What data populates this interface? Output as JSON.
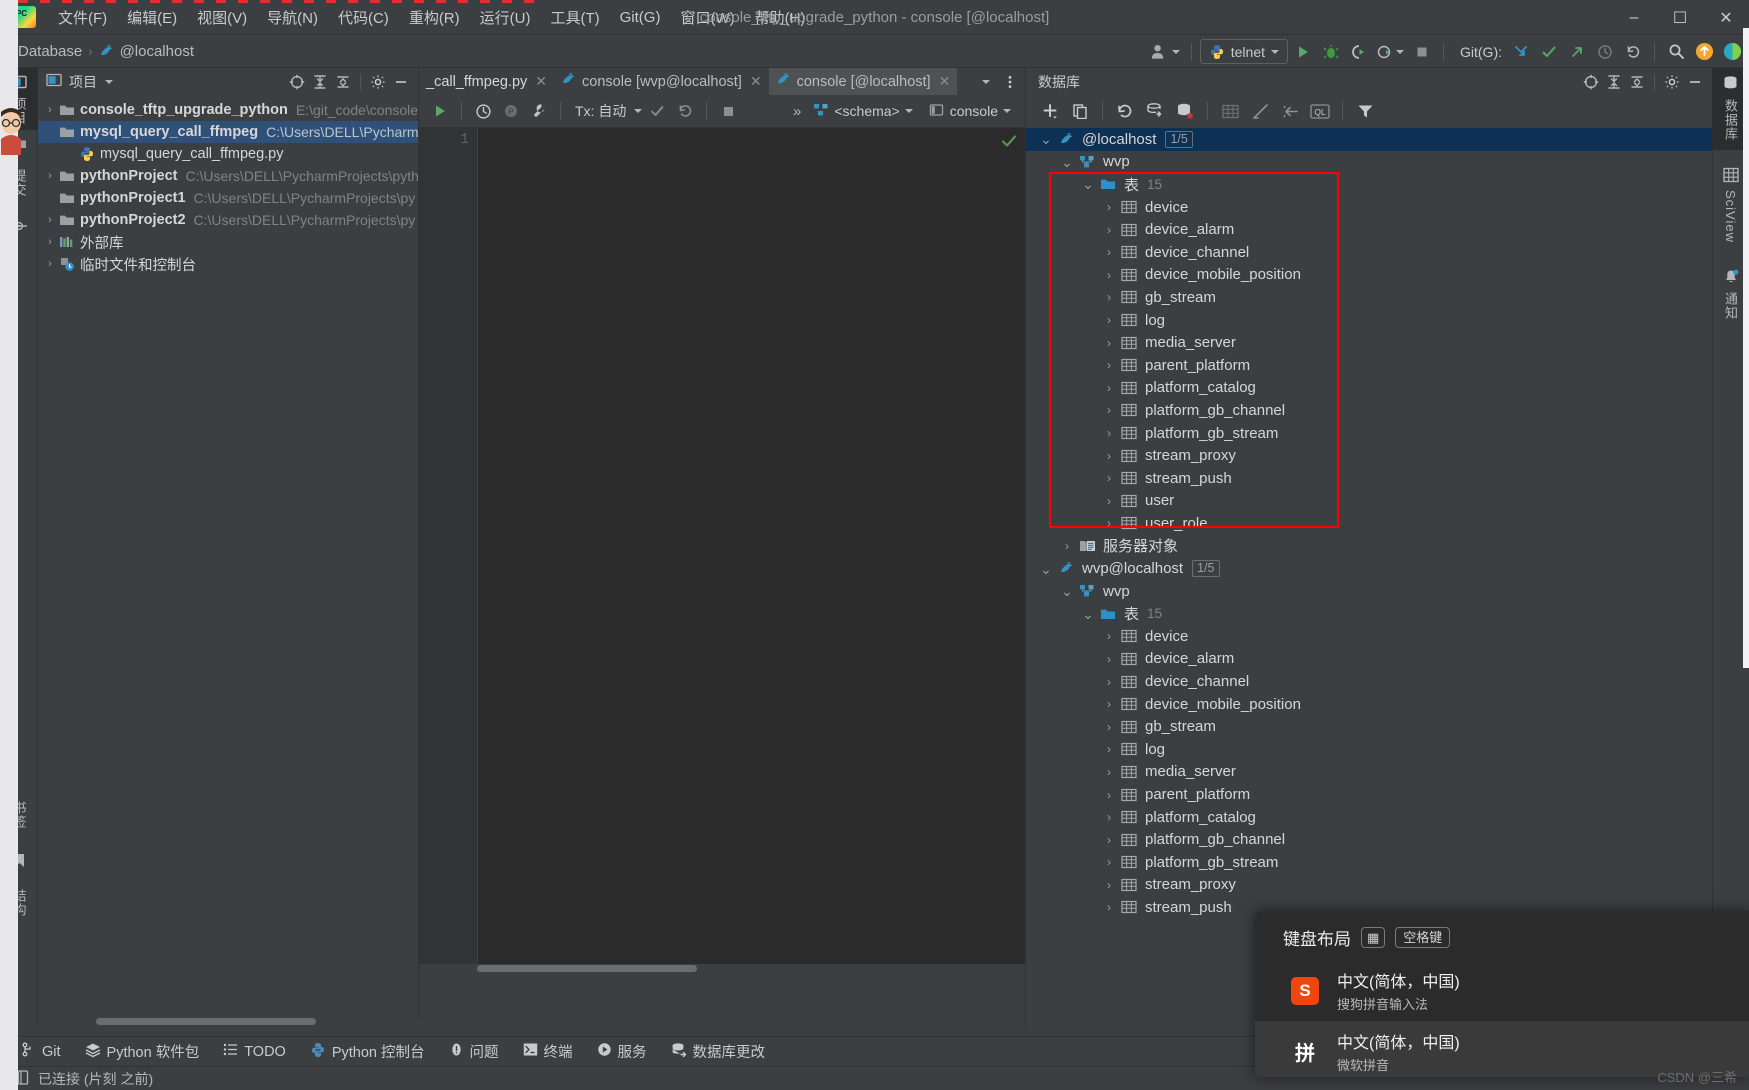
{
  "window": {
    "title": "console_tftp_upgrade_python - console [@localhost]",
    "minimize": "–",
    "maximize": "☐",
    "close": "✕"
  },
  "menubar": {
    "items": [
      {
        "label": "文件(F)"
      },
      {
        "label": "编辑(E)"
      },
      {
        "label": "视图(V)"
      },
      {
        "label": "导航(N)"
      },
      {
        "label": "代码(C)"
      },
      {
        "label": "重构(R)"
      },
      {
        "label": "运行(U)"
      },
      {
        "label": "工具(T)"
      },
      {
        "label": "Git(G)"
      },
      {
        "label": "窗口(W)"
      },
      {
        "label": "帮助(H)"
      }
    ]
  },
  "navbar": {
    "breadcrumb": [
      "Database",
      "@localhost"
    ],
    "separator": "›",
    "run_config": "telnet",
    "git_label": "Git(G):"
  },
  "left_strip": {
    "tabs": [
      {
        "label": "项目",
        "icon": "project-icon",
        "active": true
      },
      {
        "label": "",
        "icon": "folder-icon",
        "active": false
      },
      {
        "label": "提交",
        "icon": "commit-icon",
        "active": false
      },
      {
        "label": "",
        "icon": "structure-node-icon",
        "active": false
      },
      {
        "label": "书签",
        "icon": "bookmark-icon",
        "active": false
      },
      {
        "label": "结构",
        "icon": "structure-icon",
        "active": false
      }
    ]
  },
  "right_strip": {
    "tabs": [
      {
        "label": "数据库",
        "icon": "database-icon",
        "active": true
      },
      {
        "label": "SciView",
        "icon": "grid-icon",
        "active": false
      },
      {
        "label": "通知",
        "icon": "bell-icon",
        "active": false
      }
    ]
  },
  "project_panel": {
    "title": "项目",
    "tree": [
      {
        "indent": 0,
        "arrow": "›",
        "icon": "folder-icon",
        "label": "console_tftp_upgrade_python",
        "bold": true,
        "path": "E:\\git_code\\console",
        "selected": false
      },
      {
        "indent": 0,
        "arrow": "ⱟ",
        "icon": "folder-icon",
        "label": "mysql_query_call_ffmpeg",
        "bold": true,
        "path": "C:\\Users\\DELL\\PycharmP",
        "selected": true
      },
      {
        "indent": 1,
        "arrow": "",
        "icon": "python-file-icon",
        "label": "mysql_query_call_ffmpeg.py",
        "bold": false,
        "path": "",
        "selected": false
      },
      {
        "indent": 0,
        "arrow": "›",
        "icon": "folder-icon",
        "label": "pythonProject",
        "bold": true,
        "path": "C:\\Users\\DELL\\PycharmProjects\\pyth",
        "selected": false
      },
      {
        "indent": 0,
        "arrow": "ⱟ",
        "icon": "folder-icon",
        "label": "pythonProject1",
        "bold": true,
        "path": "C:\\Users\\DELL\\PycharmProjects\\py",
        "selected": false
      },
      {
        "indent": 0,
        "arrow": "›",
        "icon": "folder-icon",
        "label": "pythonProject2",
        "bold": true,
        "path": "C:\\Users\\DELL\\PycharmProjects\\py",
        "selected": false
      },
      {
        "indent": 0,
        "arrow": "›",
        "icon": "external-lib-icon",
        "label": "外部库",
        "bold": false,
        "path": "",
        "selected": false
      },
      {
        "indent": 0,
        "arrow": "›",
        "icon": "scratch-icon",
        "label": "临时文件和控制台",
        "bold": false,
        "path": "",
        "selected": false
      }
    ]
  },
  "editor": {
    "tabs": [
      {
        "label": "_call_ffmpeg.py",
        "icon": "python-file-icon",
        "active": false,
        "close": "✕"
      },
      {
        "label": "console [wvp@localhost]",
        "icon": "dolphin-icon",
        "active": false,
        "close": "✕"
      },
      {
        "label": "console [@localhost]",
        "icon": "dolphin-icon",
        "active": true,
        "close": "✕"
      }
    ],
    "console_toolbar": {
      "tx_label": "Tx:",
      "tx_value": "自动",
      "overflow": "»",
      "schema": "<schema>",
      "session": "console"
    },
    "gutter_lines": [
      "1"
    ],
    "code_text": ""
  },
  "database_panel": {
    "title": "数据库",
    "tree": [
      {
        "indent": 0,
        "arrow": "ⱟ",
        "icon": "dolphin-icon",
        "label": "@localhost",
        "badge": "1/5",
        "count": "",
        "selected": true
      },
      {
        "indent": 1,
        "arrow": "ⱟ",
        "icon": "schema-icon",
        "label": "wvp",
        "badge": "",
        "count": "",
        "selected": false
      },
      {
        "indent": 2,
        "arrow": "ⱟ",
        "icon": "folder-blue-icon",
        "label": "表",
        "badge": "",
        "count": "15",
        "selected": false
      },
      {
        "indent": 3,
        "arrow": "›",
        "icon": "table-icon",
        "label": "device",
        "badge": "",
        "count": "",
        "selected": false
      },
      {
        "indent": 3,
        "arrow": "›",
        "icon": "table-icon",
        "label": "device_alarm",
        "badge": "",
        "count": "",
        "selected": false
      },
      {
        "indent": 3,
        "arrow": "›",
        "icon": "table-icon",
        "label": "device_channel",
        "badge": "",
        "count": "",
        "selected": false
      },
      {
        "indent": 3,
        "arrow": "›",
        "icon": "table-icon",
        "label": "device_mobile_position",
        "badge": "",
        "count": "",
        "selected": false
      },
      {
        "indent": 3,
        "arrow": "›",
        "icon": "table-icon",
        "label": "gb_stream",
        "badge": "",
        "count": "",
        "selected": false
      },
      {
        "indent": 3,
        "arrow": "›",
        "icon": "table-icon",
        "label": "log",
        "badge": "",
        "count": "",
        "selected": false
      },
      {
        "indent": 3,
        "arrow": "›",
        "icon": "table-icon",
        "label": "media_server",
        "badge": "",
        "count": "",
        "selected": false
      },
      {
        "indent": 3,
        "arrow": "›",
        "icon": "table-icon",
        "label": "parent_platform",
        "badge": "",
        "count": "",
        "selected": false
      },
      {
        "indent": 3,
        "arrow": "›",
        "icon": "table-icon",
        "label": "platform_catalog",
        "badge": "",
        "count": "",
        "selected": false
      },
      {
        "indent": 3,
        "arrow": "›",
        "icon": "table-icon",
        "label": "platform_gb_channel",
        "badge": "",
        "count": "",
        "selected": false
      },
      {
        "indent": 3,
        "arrow": "›",
        "icon": "table-icon",
        "label": "platform_gb_stream",
        "badge": "",
        "count": "",
        "selected": false
      },
      {
        "indent": 3,
        "arrow": "›",
        "icon": "table-icon",
        "label": "stream_proxy",
        "badge": "",
        "count": "",
        "selected": false
      },
      {
        "indent": 3,
        "arrow": "›",
        "icon": "table-icon",
        "label": "stream_push",
        "badge": "",
        "count": "",
        "selected": false
      },
      {
        "indent": 3,
        "arrow": "›",
        "icon": "table-icon",
        "label": "user",
        "badge": "",
        "count": "",
        "selected": false
      },
      {
        "indent": 3,
        "arrow": "›",
        "icon": "table-icon",
        "label": "user_role",
        "badge": "",
        "count": "",
        "selected": false
      },
      {
        "indent": 1,
        "arrow": "›",
        "icon": "server-objects-icon",
        "label": "服务器对象",
        "badge": "",
        "count": "",
        "selected": false
      },
      {
        "indent": 0,
        "arrow": "ⱟ",
        "icon": "dolphin-icon",
        "label": "wvp@localhost",
        "badge": "1/5",
        "count": "",
        "selected": false
      },
      {
        "indent": 1,
        "arrow": "ⱟ",
        "icon": "schema-icon",
        "label": "wvp",
        "badge": "",
        "count": "",
        "selected": false
      },
      {
        "indent": 2,
        "arrow": "ⱟ",
        "icon": "folder-blue-icon",
        "label": "表",
        "badge": "",
        "count": "15",
        "selected": false
      },
      {
        "indent": 3,
        "arrow": "›",
        "icon": "table-icon",
        "label": "device",
        "badge": "",
        "count": "",
        "selected": false
      },
      {
        "indent": 3,
        "arrow": "›",
        "icon": "table-icon",
        "label": "device_alarm",
        "badge": "",
        "count": "",
        "selected": false
      },
      {
        "indent": 3,
        "arrow": "›",
        "icon": "table-icon",
        "label": "device_channel",
        "badge": "",
        "count": "",
        "selected": false
      },
      {
        "indent": 3,
        "arrow": "›",
        "icon": "table-icon",
        "label": "device_mobile_position",
        "badge": "",
        "count": "",
        "selected": false
      },
      {
        "indent": 3,
        "arrow": "›",
        "icon": "table-icon",
        "label": "gb_stream",
        "badge": "",
        "count": "",
        "selected": false
      },
      {
        "indent": 3,
        "arrow": "›",
        "icon": "table-icon",
        "label": "log",
        "badge": "",
        "count": "",
        "selected": false
      },
      {
        "indent": 3,
        "arrow": "›",
        "icon": "table-icon",
        "label": "media_server",
        "badge": "",
        "count": "",
        "selected": false
      },
      {
        "indent": 3,
        "arrow": "›",
        "icon": "table-icon",
        "label": "parent_platform",
        "badge": "",
        "count": "",
        "selected": false
      },
      {
        "indent": 3,
        "arrow": "›",
        "icon": "table-icon",
        "label": "platform_catalog",
        "badge": "",
        "count": "",
        "selected": false
      },
      {
        "indent": 3,
        "arrow": "›",
        "icon": "table-icon",
        "label": "platform_gb_channel",
        "badge": "",
        "count": "",
        "selected": false
      },
      {
        "indent": 3,
        "arrow": "›",
        "icon": "table-icon",
        "label": "platform_gb_stream",
        "badge": "",
        "count": "",
        "selected": false
      },
      {
        "indent": 3,
        "arrow": "›",
        "icon": "table-icon",
        "label": "stream_proxy",
        "badge": "",
        "count": "",
        "selected": false
      },
      {
        "indent": 3,
        "arrow": "›",
        "icon": "table-icon",
        "label": "stream_push",
        "badge": "",
        "count": "",
        "selected": false
      }
    ]
  },
  "bottom_bar": {
    "items": [
      {
        "label": "Git",
        "icon": "git-branch-icon"
      },
      {
        "label": "Python 软件包",
        "icon": "packages-icon"
      },
      {
        "label": "TODO",
        "icon": "todo-icon"
      },
      {
        "label": "Python 控制台",
        "icon": "python-icon"
      },
      {
        "label": "问题",
        "icon": "problems-icon"
      },
      {
        "label": "终端",
        "icon": "terminal-icon"
      },
      {
        "label": "服务",
        "icon": "services-icon"
      },
      {
        "label": "数据库更改",
        "icon": "db-changes-icon"
      }
    ]
  },
  "status_bar": {
    "text": "已连接 (片刻 之前)",
    "icon": "info-icon"
  },
  "ime_popup": {
    "header": "键盘布局",
    "keys": [
      "▦",
      "空格键"
    ],
    "items": [
      {
        "badge": "S",
        "badge_color": "#f0450e",
        "name": "中文(简体，中国)",
        "method": "搜狗拼音输入法",
        "highlighted": false
      },
      {
        "badge": "拼",
        "badge_color": "#2b2b2b",
        "name": "中文(简体，中国)",
        "method": "微软拼音",
        "highlighted": true
      }
    ]
  },
  "watermark": "CSDN @三希",
  "colors": {
    "accent_blue": "#2f5179",
    "db_selected": "#0d3055",
    "highlight_red": "#ff0000",
    "panel_bg": "#3c3f41",
    "editor_bg": "#2b2b2b",
    "text": "#d6d6d6",
    "muted": "#808385",
    "green": "#4f9a4f"
  }
}
